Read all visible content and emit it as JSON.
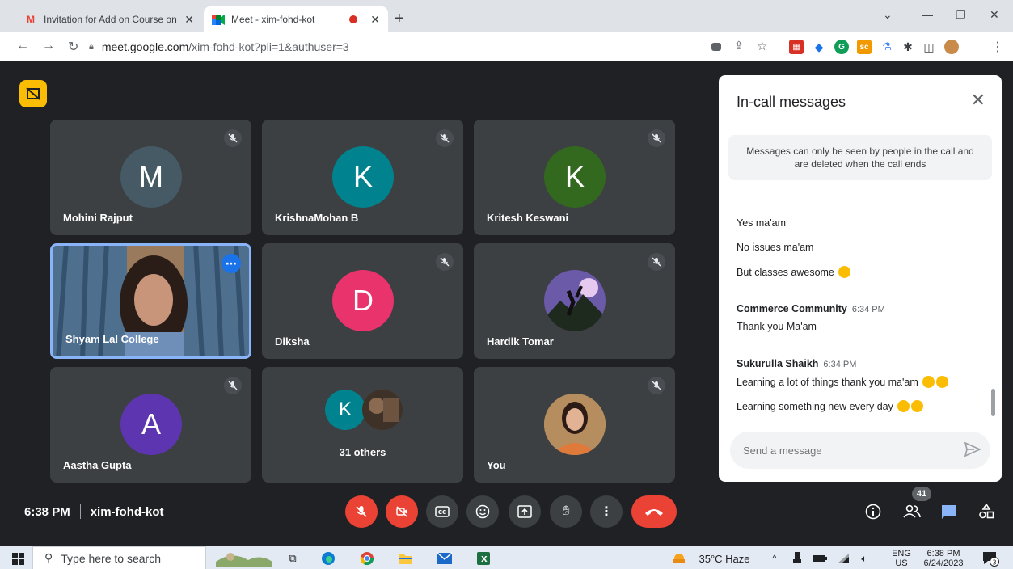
{
  "browser": {
    "tabs": [
      {
        "title": "Invitation for Add on Course on",
        "favicon": "gmail-icon"
      },
      {
        "title": "Meet - xim-fohd-kot",
        "favicon": "meet-icon"
      }
    ],
    "url_host": "meet.google.com",
    "url_path": "/xim-fohd-kot?pli=1&authuser=3"
  },
  "participants": [
    {
      "name": "Mohini Rajput",
      "initial": "M",
      "color": "#455a64"
    },
    {
      "name": "KrishnaMohan B",
      "initial": "K",
      "color": "#00838f"
    },
    {
      "name": "Kritesh Keswani",
      "initial": "K",
      "color": "#33691e"
    },
    {
      "name": "Shyam Lal College",
      "initial": "",
      "color": ""
    },
    {
      "name": "Diksha",
      "initial": "D",
      "color": "#e8336d"
    },
    {
      "name": "Hardik Tomar",
      "initial": "",
      "color": ""
    },
    {
      "name": "Aastha Gupta",
      "initial": "A",
      "color": "#5e35b1"
    },
    {
      "name": "31 others",
      "initial": "K",
      "color": "#00838f"
    },
    {
      "name": "You",
      "initial": "",
      "color": ""
    }
  ],
  "chat": {
    "title": "In-call messages",
    "notice": "Messages can only be seen by people in the call and are deleted when the call ends",
    "messages_top": [
      "Yes ma'am",
      "No issues ma'am",
      "But classes awesome"
    ],
    "group1": {
      "sender": "Commerce Community",
      "time": "6:34 PM",
      "messages": [
        "Thank you Ma'am"
      ]
    },
    "group2": {
      "sender": "Sukurulla Shaikh",
      "time": "6:34 PM",
      "messages": [
        "Learning a lot of things  thank you ma'am",
        "Learning something new every day"
      ]
    },
    "input_placeholder": "Send a message"
  },
  "meeting": {
    "time": "6:38 PM",
    "code": "xim-fohd-kot",
    "participant_count": "41"
  },
  "taskbar": {
    "search_placeholder": "Type here to search",
    "weather": "35°C  Haze",
    "lang1": "ENG",
    "lang2": "US",
    "clock_time": "6:38 PM",
    "clock_date": "6/24/2023",
    "notif_count": "3"
  }
}
